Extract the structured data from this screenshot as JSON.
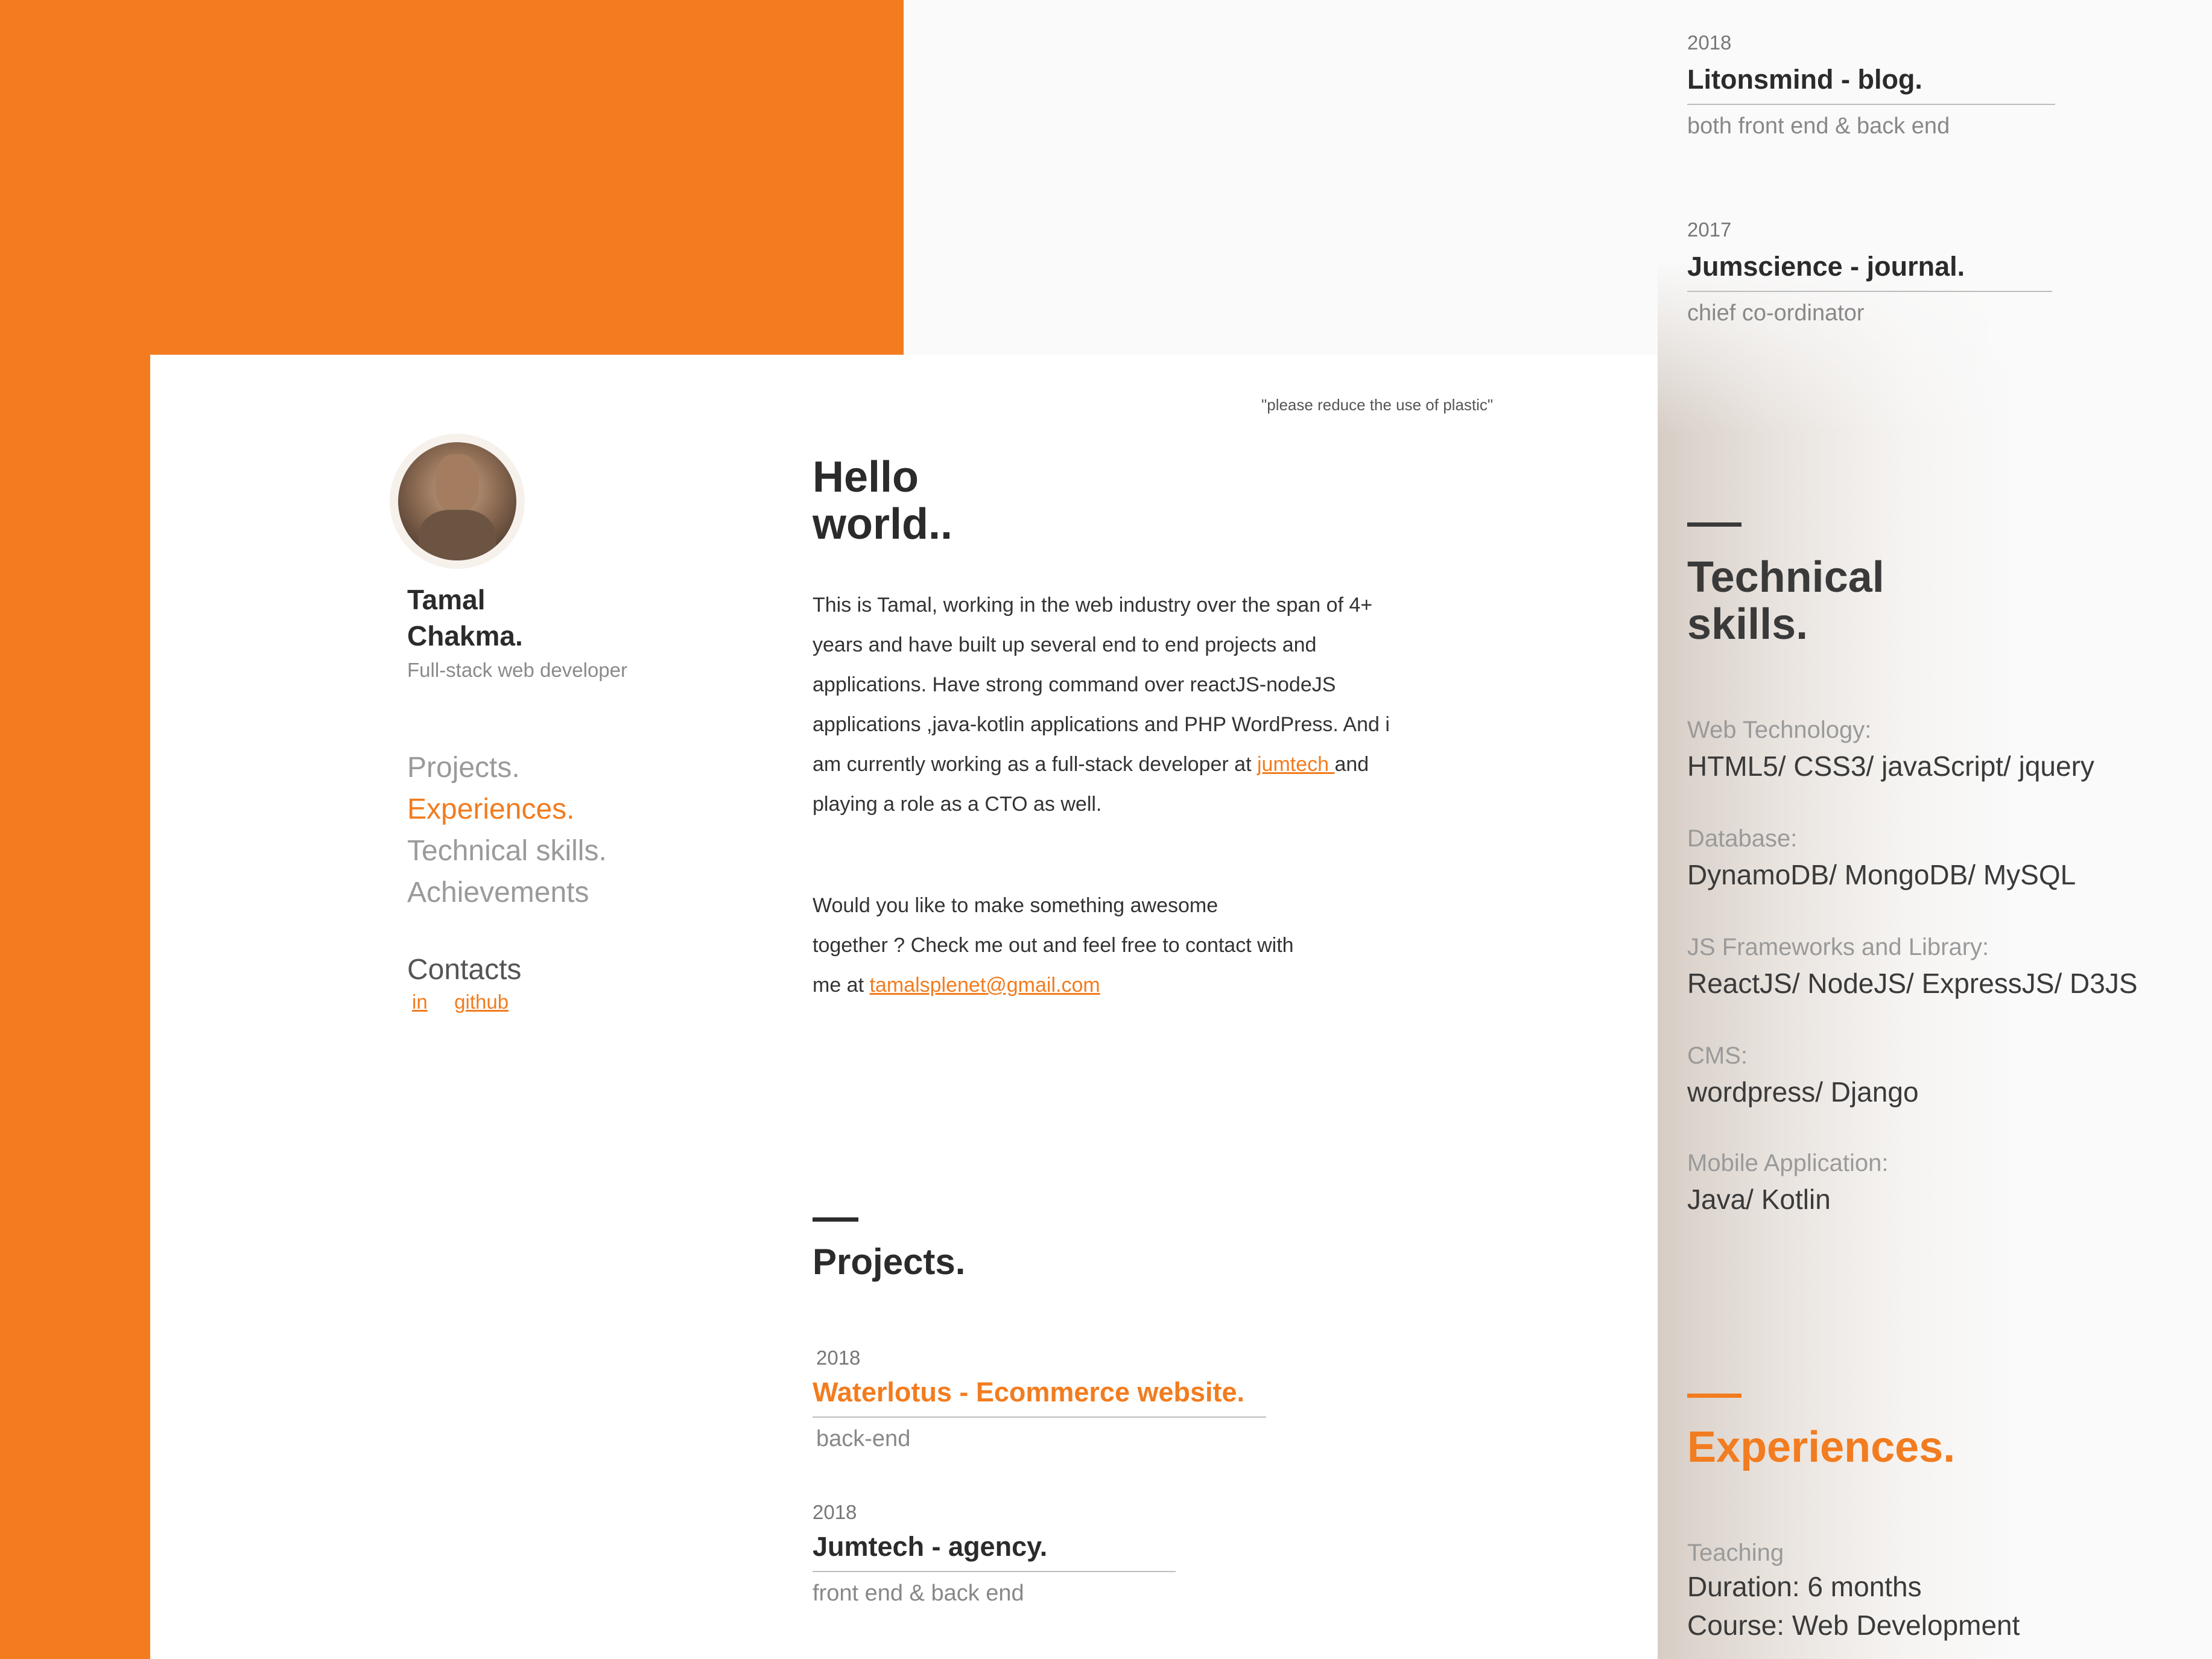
{
  "quote": "\"please reduce the use of plastic\"",
  "profile": {
    "name_line1": "Tamal",
    "name_line2": "Chakma.",
    "role": "Full-stack web developer"
  },
  "nav": {
    "items": [
      "Projects.",
      "Experiences.",
      "Technical skills.",
      "Achievements"
    ],
    "active_index": 1
  },
  "contacts": {
    "label": "Contacts",
    "linkedin": "in",
    "github": "github"
  },
  "intro": {
    "hello_line1": "Hello",
    "hello_line2": "world..",
    "p1_lines": [
      "This is Tamal, working in the web industry over the span of 4+",
      "years and have built up several end to end projects and",
      "applications. Have strong command over reactJS-nodeJS",
      "applications ,java-kotlin applications and PHP WordPress. And i"
    ],
    "p1_line5_before": "am currently working as a full-stack developer at ",
    "p1_link": "jumtech ",
    "p1_line5_after": "and",
    "p1_line6": "playing a role as a CTO as well.",
    "p2_lines": [
      "Would you like to make something awesome",
      "together ? Check me out and feel free to contact with"
    ],
    "p2_line3_before": "me at ",
    "email": "tamalsplenet@gmail.com"
  },
  "projects": {
    "title": "Projects.",
    "items": [
      {
        "year": "2018",
        "title": "Waterlotus - Ecommerce website.",
        "sub": "back-end"
      },
      {
        "year": "2018",
        "title": "Jumtech - agency.",
        "sub": "front end & back end"
      }
    ]
  },
  "right_projects": [
    {
      "year": "2018",
      "title": "Litonsmind - blog.",
      "sub": "both front end & back end"
    },
    {
      "year": "2017",
      "title": "Jumscience - journal.",
      "sub": "chief co-ordinator"
    }
  ],
  "skills": {
    "title_line1": "Technical",
    "title_line2": "skills.",
    "items": [
      {
        "label": "Web Technology:",
        "value": "HTML5/ CSS3/ javaScript/ jquery"
      },
      {
        "label": "Database:",
        "value": "DynamoDB/ MongoDB/ MySQL"
      },
      {
        "label": "JS Frameworks and Library:",
        "value": "ReactJS/ NodeJS/ ExpressJS/ D3JS"
      },
      {
        "label": "CMS:",
        "value": "wordpress/ Django"
      },
      {
        "label": "Mobile Application:",
        "value": "Java/ Kotlin"
      }
    ]
  },
  "experiences": {
    "title": "Experiences.",
    "label": "Teaching",
    "line1": "Duration: 6 months",
    "line2": "Course: Web Development"
  },
  "colors": {
    "accent": "#f27c1f",
    "text": "#2b2b2b",
    "muted": "#9a9a9a"
  }
}
